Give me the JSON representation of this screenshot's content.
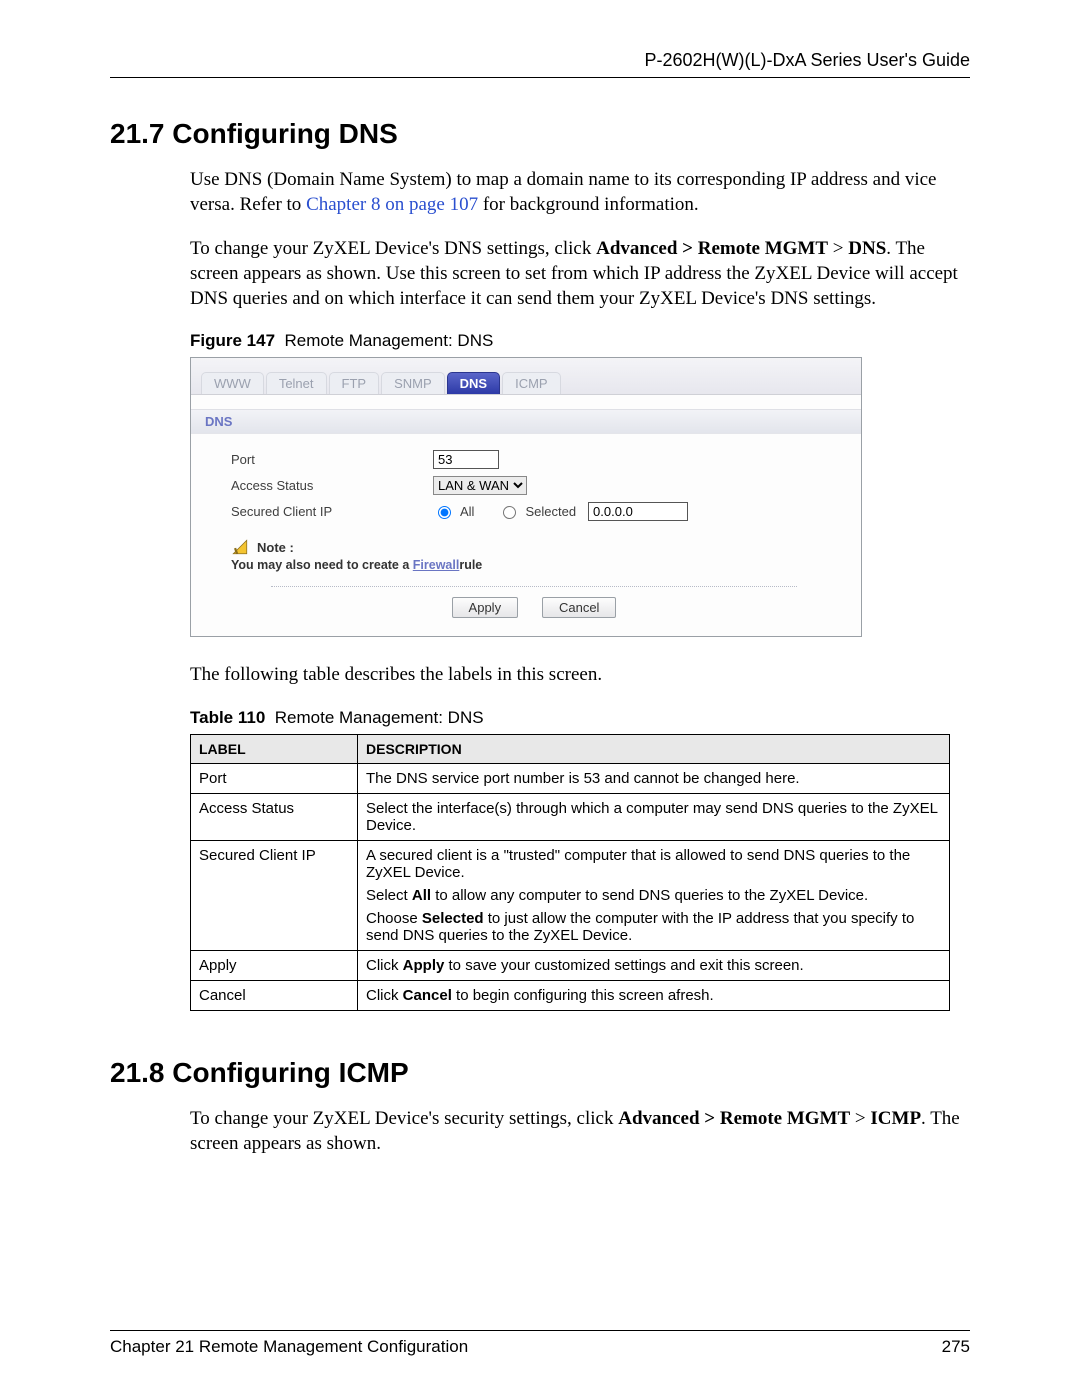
{
  "header": {
    "guide_title": "P-2602H(W)(L)-DxA Series User's Guide"
  },
  "sec1": {
    "heading": "21.7  Configuring DNS",
    "p1a": "Use DNS (Domain Name System) to map a domain name to its corresponding IP address and vice versa. Refer to ",
    "p1link": "Chapter 8 on page 107",
    "p1b": " for background information.",
    "p2": "To change your ZyXEL Device's DNS settings, click Advanced > Remote MGMT > DNS. The screen appears as shown. Use this screen to set from which IP address the ZyXEL Device will accept DNS queries and on which interface it can send them your ZyXEL Device's DNS settings."
  },
  "fig": {
    "caption_num": "Figure 147",
    "caption_txt": "Remote Management: DNS",
    "tabs": [
      "WWW",
      "Telnet",
      "FTP",
      "SNMP",
      "DNS",
      "ICMP"
    ],
    "active_tab": "DNS",
    "panel_title": "DNS",
    "labels": {
      "port": "Port",
      "access": "Access Status",
      "secured": "Secured Client IP"
    },
    "port_value": "53",
    "access_value": "LAN & WAN",
    "radio_all": "All",
    "radio_selected": "Selected",
    "ip_value": "0.0.0.0",
    "note_label": "Note :",
    "note_text_a": "You may also need to create a ",
    "note_link": "Firewall",
    "note_text_b": "rule",
    "btn_apply": "Apply",
    "btn_cancel": "Cancel"
  },
  "after_fig": "The following table describes the labels in this screen.",
  "tbl": {
    "caption_num": "Table 110",
    "caption_txt": "Remote Management: DNS",
    "head_label": "LABEL",
    "head_desc": "DESCRIPTION",
    "rows": [
      {
        "label": "Port",
        "paras": [
          "The DNS service port number is 53 and cannot be changed here."
        ]
      },
      {
        "label": "Access Status",
        "paras": [
          "Select the interface(s) through which a computer may send DNS queries to the ZyXEL Device."
        ]
      },
      {
        "label": "Secured Client IP",
        "paras": [
          "A secured client is a \"trusted\" computer that is allowed to send DNS queries to the ZyXEL Device.",
          "Select All to allow any computer to send DNS queries to the ZyXEL Device.",
          "Choose Selected to just allow the computer with the IP address that you specify to send DNS queries to the ZyXEL Device."
        ]
      },
      {
        "label": "Apply",
        "paras": [
          "Click Apply to save your customized settings and exit this screen."
        ]
      },
      {
        "label": "Cancel",
        "paras": [
          "Click Cancel to begin configuring this screen afresh."
        ]
      }
    ]
  },
  "sec2": {
    "heading": "21.8  Configuring ICMP",
    "p1": "To change your ZyXEL Device's security settings, click Advanced > Remote MGMT > ICMP. The screen appears as shown."
  },
  "footer": {
    "chapter": "Chapter 21 Remote Management Configuration",
    "page": "275"
  }
}
